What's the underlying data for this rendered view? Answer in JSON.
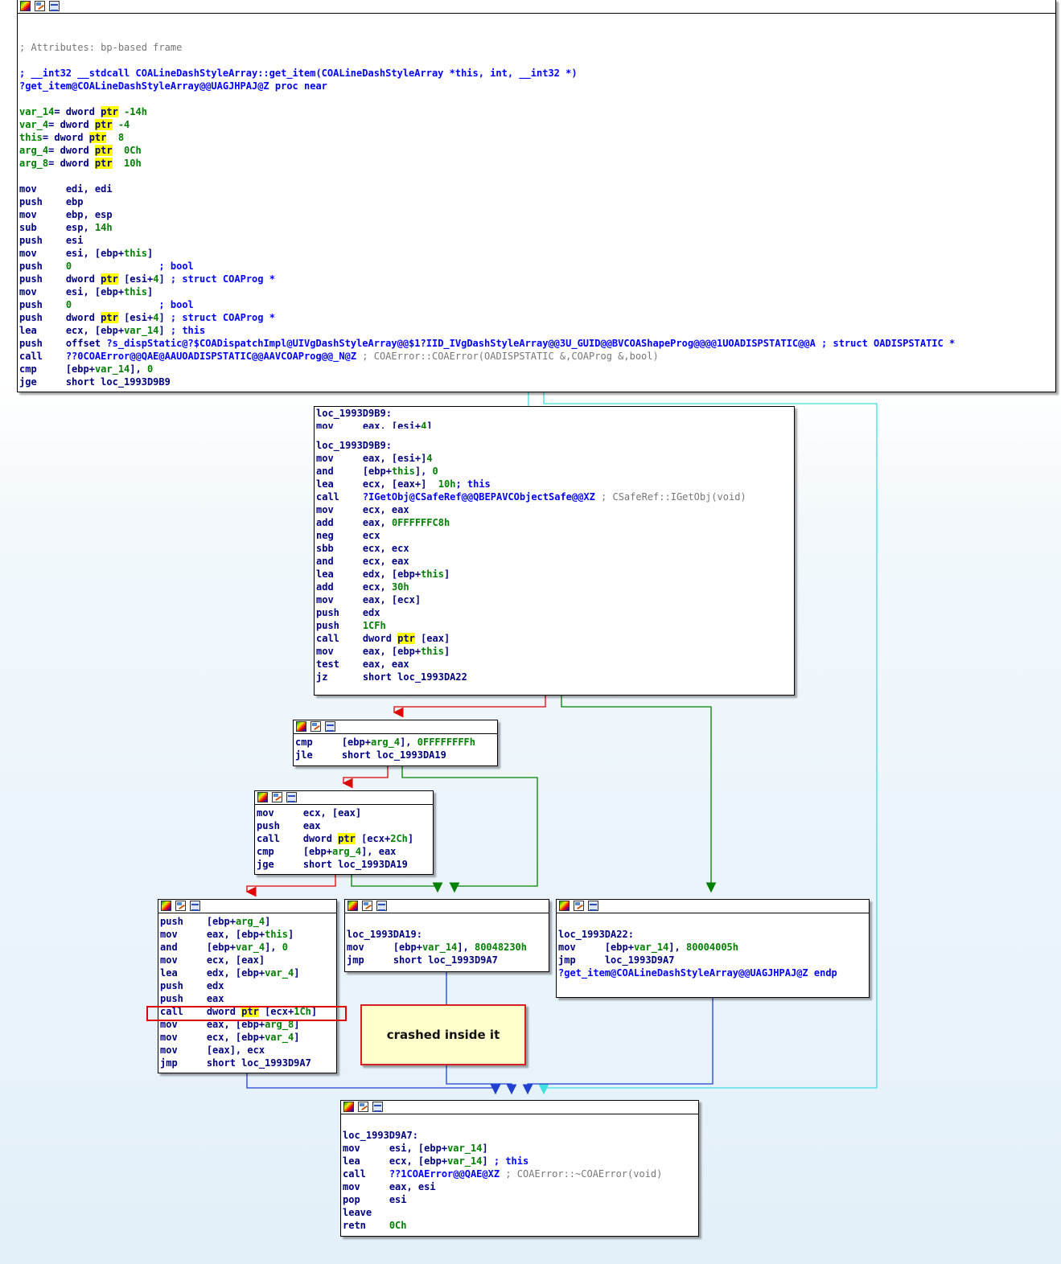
{
  "blocks": {
    "entry": {
      "lines": [
        {
          "t": "comment",
          "text": "; Attributes: bp-based frame"
        },
        {
          "t": "blank"
        },
        {
          "t": "sig",
          "text": "; __int32 __stdcall COALineDashStyleArray::get_item(COALineDashStyleArray *this, int, __int32 *)"
        },
        {
          "t": "sig",
          "text": "?get_item@COALineDashStyleArray@@UAGJHPAJ@Z proc near"
        },
        {
          "t": "blank"
        },
        {
          "t": "var",
          "name": "var_14",
          "rest": "= dword ",
          "kw": "ptr",
          "val": " -14h"
        },
        {
          "t": "var",
          "name": "var_4",
          "rest": "= dword ",
          "kw": "ptr",
          "val": " -4"
        },
        {
          "t": "var",
          "name": "this",
          "rest": "= dword ",
          "kw": "ptr",
          "val": "  8"
        },
        {
          "t": "var",
          "name": "arg_4",
          "rest": "= dword ",
          "kw": "ptr",
          "val": "  0Ch"
        },
        {
          "t": "var",
          "name": "arg_8",
          "rest": "= dword ",
          "kw": "ptr",
          "val": "  10h"
        },
        {
          "t": "blank"
        },
        {
          "t": "ins",
          "m": "mov",
          "ops": "edi, edi"
        },
        {
          "t": "ins",
          "m": "push",
          "ops": "ebp"
        },
        {
          "t": "ins",
          "m": "mov",
          "ops": "ebp, esp"
        },
        {
          "t": "ins",
          "m": "sub",
          "ops": "esp, ",
          "num": "14h"
        },
        {
          "t": "ins",
          "m": "push",
          "ops": "esi"
        },
        {
          "t": "ins",
          "m": "mov",
          "ops": "esi, [ebp+",
          "var": "this",
          "ops2": "]"
        },
        {
          "t": "ins",
          "m": "push",
          "num0": "0",
          "pad": "               ",
          "cm": "; bool"
        },
        {
          "t": "ins",
          "m": "push",
          "ops": "dword ",
          "hl": "ptr",
          "ops2": " [esi+",
          "num2": "4",
          "ops3": "] ",
          "cm": "; struct COAProg *"
        },
        {
          "t": "ins",
          "m": "mov",
          "ops": "esi, [ebp+",
          "var": "this",
          "ops2": "]"
        },
        {
          "t": "ins",
          "m": "push",
          "num0": "0",
          "pad": "               ",
          "cm": "; bool"
        },
        {
          "t": "ins",
          "m": "push",
          "ops": "dword ",
          "hl": "ptr",
          "ops2": " [esi+",
          "num2": "4",
          "ops3": "] ",
          "cm": "; struct COAProg *"
        },
        {
          "t": "ins",
          "m": "lea",
          "ops": "ecx, [ebp+",
          "var": "var_14",
          "ops2": "] ",
          "cm": "; this"
        },
        {
          "t": "ins",
          "m": "push",
          "ops": "offset ",
          "f": "?s_dispStatic@?$COADispatchImpl@UIVgDashStyleArray@@$1?IID_IVgDashStyleArray@@3U_GUID@@BVCOAShapeProg@@@@1UOADISPSTATIC@@A",
          "cm": " ; struct OADISPSTATIC *"
        },
        {
          "t": "ins",
          "m": "call",
          "f": "??0COAError@@QAE@AAUOADISPSTATIC@@AAVCOAProg@@_N@Z",
          "cg": " ; COAError::COAError(OADISPSTATIC &,COAProg &,bool)"
        },
        {
          "t": "ins",
          "m": "cmp",
          "ops": "[ebp+",
          "var": "var_14",
          "ops2": "], ",
          "num2": "0"
        },
        {
          "t": "ins",
          "m": "jge",
          "ops": "short loc_1993D9B9"
        }
      ]
    },
    "b1": {
      "lines": [
        {
          "t": "label",
          "text": "loc_1993D9B9:"
        },
        {
          "t": "ins",
          "m": "mov",
          "ops": "eax, [esi+",
          "num2": "4",
          "ops2": "]"
        },
        {
          "t": "ins",
          "m": "and",
          "ops": "[ebp+",
          "var": "this",
          "ops2": "], ",
          "num2": "0"
        },
        {
          "t": "ins",
          "m": "lea",
          "ops": "ecx, [eax+",
          "num2": "10h",
          "ops2": "]  ",
          "cm": "; this"
        },
        {
          "t": "ins",
          "m": "call",
          "f": "?IGetObj@CSafeRef@@QBEPAVCObjectSafe@@XZ",
          "cg": " ; CSafeRef::IGetObj(void)"
        },
        {
          "t": "ins",
          "m": "mov",
          "ops": "ecx, eax"
        },
        {
          "t": "ins",
          "m": "add",
          "ops": "eax, ",
          "num": "0FFFFFFC8h"
        },
        {
          "t": "ins",
          "m": "neg",
          "ops": "ecx"
        },
        {
          "t": "ins",
          "m": "sbb",
          "ops": "ecx, ecx"
        },
        {
          "t": "ins",
          "m": "and",
          "ops": "ecx, eax"
        },
        {
          "t": "ins",
          "m": "lea",
          "ops": "edx, [ebp+",
          "var": "this",
          "ops2": "]"
        },
        {
          "t": "ins",
          "m": "add",
          "ops": "ecx, ",
          "num": "30h"
        },
        {
          "t": "ins",
          "m": "mov",
          "ops": "eax, [ecx]"
        },
        {
          "t": "ins",
          "m": "push",
          "ops": "edx"
        },
        {
          "t": "ins",
          "m": "push",
          "num0": "1CFh"
        },
        {
          "t": "ins",
          "m": "call",
          "ops": "dword ",
          "hl": "ptr",
          "ops2": " [eax]"
        },
        {
          "t": "ins",
          "m": "mov",
          "ops": "eax, [ebp+",
          "var": "this",
          "ops2": "]"
        },
        {
          "t": "ins",
          "m": "test",
          "ops": "eax, eax"
        },
        {
          "t": "ins",
          "m": "jz",
          "ops": "short loc_1993DA22"
        }
      ]
    },
    "b2": {
      "lines": [
        {
          "t": "ins",
          "m": "cmp",
          "ops": "[ebp+",
          "var": "arg_4",
          "ops2": "], ",
          "num2": "0FFFFFFFFh"
        },
        {
          "t": "ins",
          "m": "jle",
          "ops": "short loc_1993DA19"
        }
      ]
    },
    "b3": {
      "lines": [
        {
          "t": "ins",
          "m": "mov",
          "ops": "ecx, [eax]"
        },
        {
          "t": "ins",
          "m": "push",
          "ops": "eax"
        },
        {
          "t": "ins",
          "m": "call",
          "ops": "dword ",
          "hl": "ptr",
          "ops2": " [ecx+",
          "num2": "2Ch",
          "ops3": "]"
        },
        {
          "t": "ins",
          "m": "cmp",
          "ops": "[ebp+",
          "var": "arg_4",
          "ops2": "], eax"
        },
        {
          "t": "ins",
          "m": "jge",
          "ops": "short loc_1993DA19"
        }
      ]
    },
    "b4": {
      "lines": [
        {
          "t": "ins",
          "m": "push",
          "ops": "[ebp+",
          "var": "arg_4",
          "ops2": "]"
        },
        {
          "t": "ins",
          "m": "mov",
          "ops": "eax, [ebp+",
          "var": "this",
          "ops2": "]"
        },
        {
          "t": "ins",
          "m": "and",
          "ops": "[ebp+",
          "var": "var_4",
          "ops2": "], ",
          "num2": "0"
        },
        {
          "t": "ins",
          "m": "mov",
          "ops": "ecx, [eax]"
        },
        {
          "t": "ins",
          "m": "lea",
          "ops": "edx, [ebp+",
          "var": "var_4",
          "ops2": "]"
        },
        {
          "t": "ins",
          "m": "push",
          "ops": "edx"
        },
        {
          "t": "ins",
          "m": "push",
          "ops": "eax"
        },
        {
          "t": "ins",
          "m": "call",
          "ops": "dword ",
          "hl": "ptr",
          "ops2": " [ecx+",
          "num2": "1Ch",
          "ops3": "]"
        },
        {
          "t": "ins",
          "m": "mov",
          "ops": "eax, [ebp+",
          "var": "arg_8",
          "ops2": "]"
        },
        {
          "t": "ins",
          "m": "mov",
          "ops": "ecx, [ebp+",
          "var": "var_4",
          "ops2": "]"
        },
        {
          "t": "ins",
          "m": "mov",
          "ops": "[eax], ecx"
        },
        {
          "t": "ins",
          "m": "jmp",
          "ops": "short loc_1993D9A7"
        }
      ]
    },
    "b5": {
      "lines": [
        {
          "t": "blank"
        },
        {
          "t": "label",
          "text": "loc_1993DA19:"
        },
        {
          "t": "ins",
          "m": "mov",
          "ops": "[ebp+",
          "var": "var_14",
          "ops2": "], ",
          "num2": "80048230h"
        },
        {
          "t": "ins",
          "m": "jmp",
          "ops": "short loc_1993D9A7"
        }
      ]
    },
    "b6": {
      "lines": [
        {
          "t": "blank"
        },
        {
          "t": "label",
          "text": "loc_1993DA22:"
        },
        {
          "t": "ins",
          "m": "mov",
          "ops": "[ebp+",
          "var": "var_14",
          "ops2": "], ",
          "num2": "80004005h"
        },
        {
          "t": "ins",
          "m": "jmp",
          "ops": "loc_1993D9A7"
        },
        {
          "t": "sig",
          "text": "?get_item@COALineDashStyleArray@@UAGJHPAJ@Z endp"
        }
      ]
    },
    "b7": {
      "lines": [
        {
          "t": "blank"
        },
        {
          "t": "label",
          "text": "loc_1993D9A7:"
        },
        {
          "t": "ins",
          "m": "mov",
          "ops": "esi, [ebp+",
          "var": "var_14",
          "ops2": "]"
        },
        {
          "t": "ins",
          "m": "lea",
          "ops": "ecx, [ebp+",
          "var": "var_14",
          "ops2": "] ",
          "cm": "; this"
        },
        {
          "t": "ins",
          "m": "call",
          "f": "??1COAError@@QAE@XZ",
          "cg": " ; COAError::~COAError(void)"
        },
        {
          "t": "ins",
          "m": "mov",
          "ops": "eax, esi"
        },
        {
          "t": "ins",
          "m": "pop",
          "ops": "esi"
        },
        {
          "t": "ins",
          "m": "leave"
        },
        {
          "t": "ins",
          "m": "retn",
          "num0": "0Ch"
        }
      ]
    }
  },
  "annotation": {
    "text": "crashed inside it"
  },
  "colors": {
    "true_edge": "#008000",
    "false_edge": "#e00000",
    "uncond_edge": "#2040d0",
    "cyan_edge": "#40e0e0",
    "highlight": "#ffff00",
    "name": "#000080"
  }
}
